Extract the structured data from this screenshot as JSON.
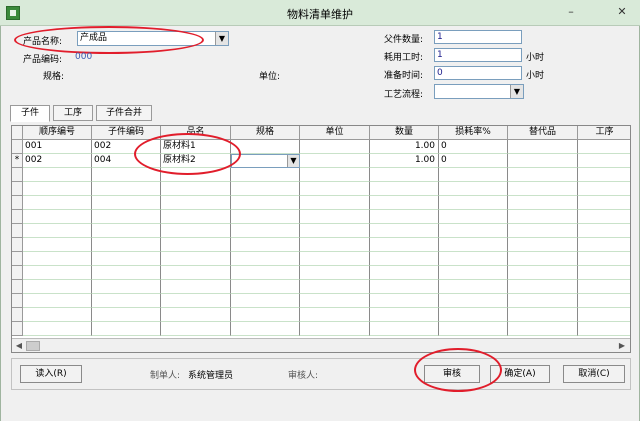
{
  "window": {
    "title": "物料清单维护",
    "minimize": "–",
    "close": "✕"
  },
  "header": {
    "product_name_label": "产品名称:",
    "product_name_value": "产成品",
    "product_code_label": "产品编码:",
    "product_code_value": "000",
    "spec_label": "规格:",
    "unit_label": "单位:",
    "parent_qty_label": "父件数量:",
    "parent_qty_value": "1",
    "work_hours_label": "耗用工时:",
    "work_hours_value": "1",
    "work_hours_unit": "小时",
    "prep_time_label": "准备时间:",
    "prep_time_value": "0",
    "prep_time_unit": "小时",
    "process_label": "工艺流程:",
    "process_value": ""
  },
  "tabs": [
    "子件",
    "工序",
    "子件合并"
  ],
  "grid": {
    "columns": [
      "顺序编号",
      "子件编码",
      "品名",
      "规格",
      "单位",
      "数量",
      "损耗率%",
      "替代品",
      "工序"
    ],
    "rows": [
      {
        "marker": "",
        "seq": "001",
        "code": "002",
        "name": "原材料1",
        "spec": "",
        "unit": "",
        "qty": "1.00",
        "loss": "0",
        "sub": "",
        "proc": ""
      },
      {
        "marker": "*",
        "seq": "002",
        "code": "004",
        "name": "原材料2",
        "spec": "",
        "unit": "",
        "qty": "1.00",
        "loss": "0",
        "sub": "",
        "proc": ""
      }
    ]
  },
  "footer": {
    "read_in": "读入(R)",
    "creator_label": "制单人:",
    "creator_value": "系统管理员",
    "reviewer_label": "审核人:",
    "audit": "审核",
    "confirm": "确定(A)",
    "cancel": "取消(C)"
  },
  "colors": {
    "annotation": "#e11d2b",
    "titlebar": "#d9ead9",
    "value_text": "#1a1a8a"
  }
}
